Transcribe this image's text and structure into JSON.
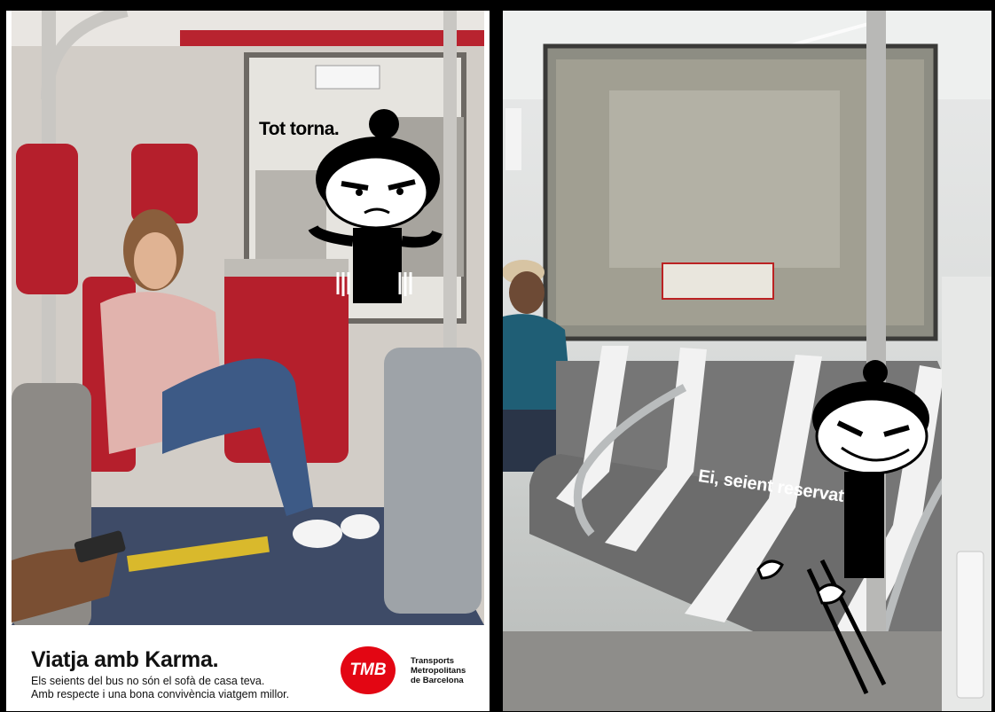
{
  "poster": {
    "speech": "Tot torna.",
    "headline": "Viatja amb Karma.",
    "line1": "Els seients del bus no són el sofà de casa teva.",
    "line2": "Amb respecte i una bona convivència viatgem millor.",
    "logo_text": "TMB",
    "brand_line1": "Transports",
    "brand_line2": "Metropolitans",
    "brand_line3": "de Barcelona",
    "brand_color": "#e30613"
  },
  "metro": {
    "seat_text": "Ei, seient reservat"
  }
}
